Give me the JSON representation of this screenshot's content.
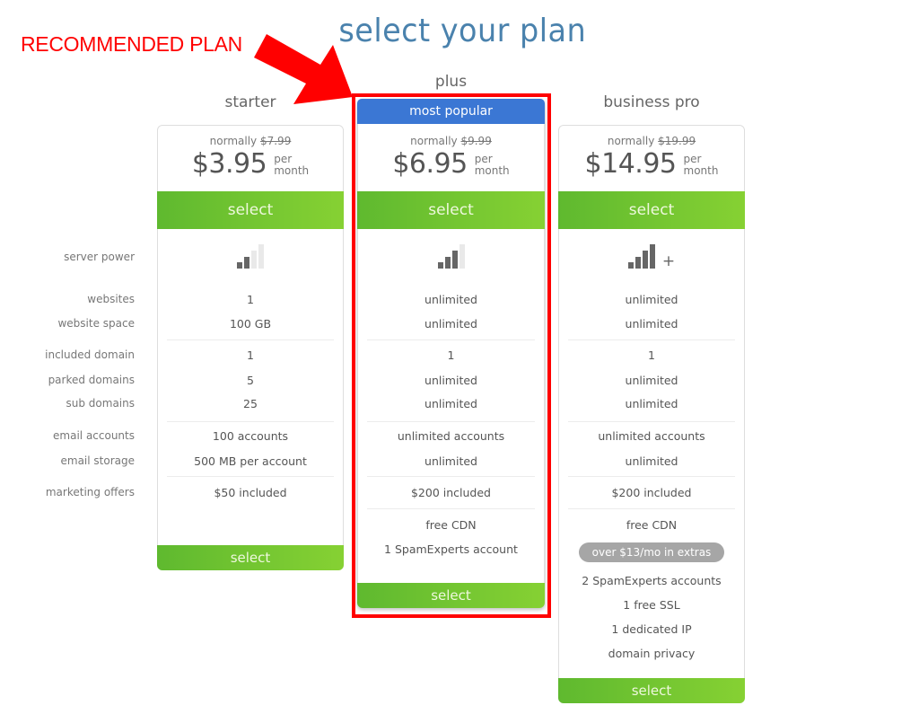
{
  "page_title": "select your plan",
  "annotation": {
    "label": "RECOMMENDED PLAN",
    "color": "#ff0000",
    "icon": "arrow-down-right-icon"
  },
  "feature_labels": [
    "server power",
    "websites",
    "website space",
    "included domain",
    "parked domains",
    "sub domains",
    "email accounts",
    "email storage",
    "marketing offers"
  ],
  "plans": [
    {
      "name": "starter",
      "normally_label": "normally",
      "normal_price": "$7.99",
      "price": "$3.95",
      "per": "per",
      "period": "month",
      "select_label": "select",
      "server_power_level": 2,
      "server_power_max": 4,
      "server_power_plus": false,
      "features": {
        "websites": "1",
        "website_space": "100 GB",
        "included_domain": "1",
        "parked_domains": "5",
        "sub_domains": "25",
        "email_accounts": "100 accounts",
        "email_storage": "500 MB per account",
        "marketing_offers": "$50 included"
      },
      "extras": []
    },
    {
      "name": "plus",
      "badge": "most popular",
      "recommended": true,
      "normally_label": "normally",
      "normal_price": "$9.99",
      "price": "$6.95",
      "per": "per",
      "period": "month",
      "select_label": "select",
      "server_power_level": 3,
      "server_power_max": 4,
      "server_power_plus": false,
      "features": {
        "websites": "unlimited",
        "website_space": "unlimited",
        "included_domain": "1",
        "parked_domains": "unlimited",
        "sub_domains": "unlimited",
        "email_accounts": "unlimited accounts",
        "email_storage": "unlimited",
        "marketing_offers": "$200 included"
      },
      "extras": [
        "free CDN",
        "1 SpamExperts account"
      ]
    },
    {
      "name": "business pro",
      "normally_label": "normally",
      "normal_price": "$19.99",
      "price": "$14.95",
      "per": "per",
      "period": "month",
      "select_label": "select",
      "server_power_level": 4,
      "server_power_max": 4,
      "server_power_plus": true,
      "server_power_plus_label": "+",
      "features": {
        "websites": "unlimited",
        "website_space": "unlimited",
        "included_domain": "1",
        "parked_domains": "unlimited",
        "sub_domains": "unlimited",
        "email_accounts": "unlimited accounts",
        "email_storage": "unlimited",
        "marketing_offers": "$200 included"
      },
      "extras_badge": "over $13/mo in extras",
      "extras": [
        "free CDN",
        "2 SpamExperts accounts",
        "1 free SSL",
        "1 dedicated IP",
        "domain privacy"
      ]
    }
  ],
  "colors": {
    "title": "#3d78a8",
    "badge": "#3b77d4",
    "select_green_start": "#5fb92f",
    "select_green_end": "#86d133",
    "highlight": "#ff0000",
    "extras_pill": "#a6a6a6"
  }
}
